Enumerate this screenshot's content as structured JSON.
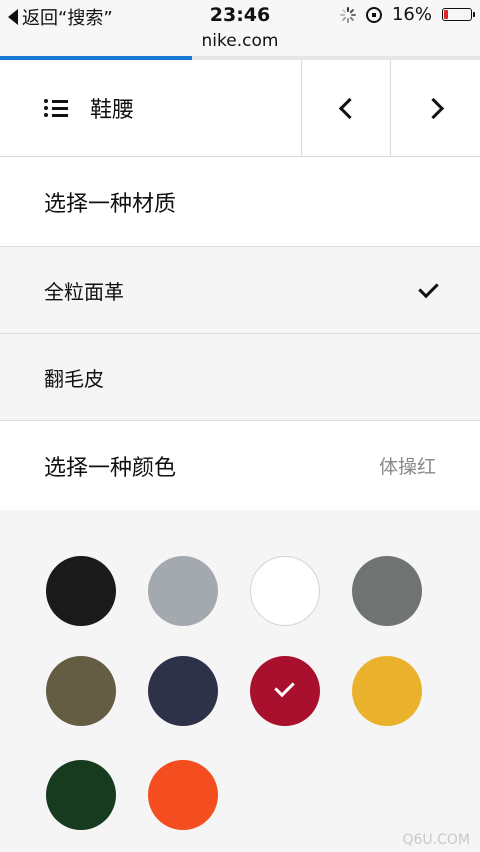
{
  "statusbar": {
    "back_label": "返回“搜索”",
    "time": "23:46",
    "battery_percent": "16%",
    "battery_level": 0.16,
    "battery_color": "#e0262b"
  },
  "urlbar": {
    "url": "nike.com",
    "load_progress": 0.4,
    "progress_color": "#1976d2"
  },
  "nav": {
    "menu_icon": "list-icon",
    "title": "鞋腰",
    "prev_icon": "chevron-left-icon",
    "next_icon": "chevron-right-icon"
  },
  "material": {
    "heading": "选择一种材质",
    "options": [
      {
        "label": "全粒面革",
        "selected": true
      },
      {
        "label": "翻毛皮",
        "selected": false
      }
    ]
  },
  "color": {
    "heading": "选择一种颜色",
    "selected_name": "体操红",
    "swatches": [
      {
        "hex": "#1a1a1a",
        "selected": false
      },
      {
        "hex": "#a4a9b0",
        "selected": false
      },
      {
        "hex": "#ffffff",
        "selected": false
      },
      {
        "hex": "#6f7472",
        "selected": false
      },
      {
        "hex": "#645d43",
        "selected": false
      },
      {
        "hex": "#2e3249",
        "selected": false
      },
      {
        "hex": "#a8102e",
        "selected": true
      },
      {
        "hex": "#e9b12c",
        "selected": false
      },
      {
        "hex": "#163b1e",
        "selected": false
      },
      {
        "hex": "#f44d1f",
        "selected": false
      }
    ]
  },
  "watermark": "Q6U.COM"
}
